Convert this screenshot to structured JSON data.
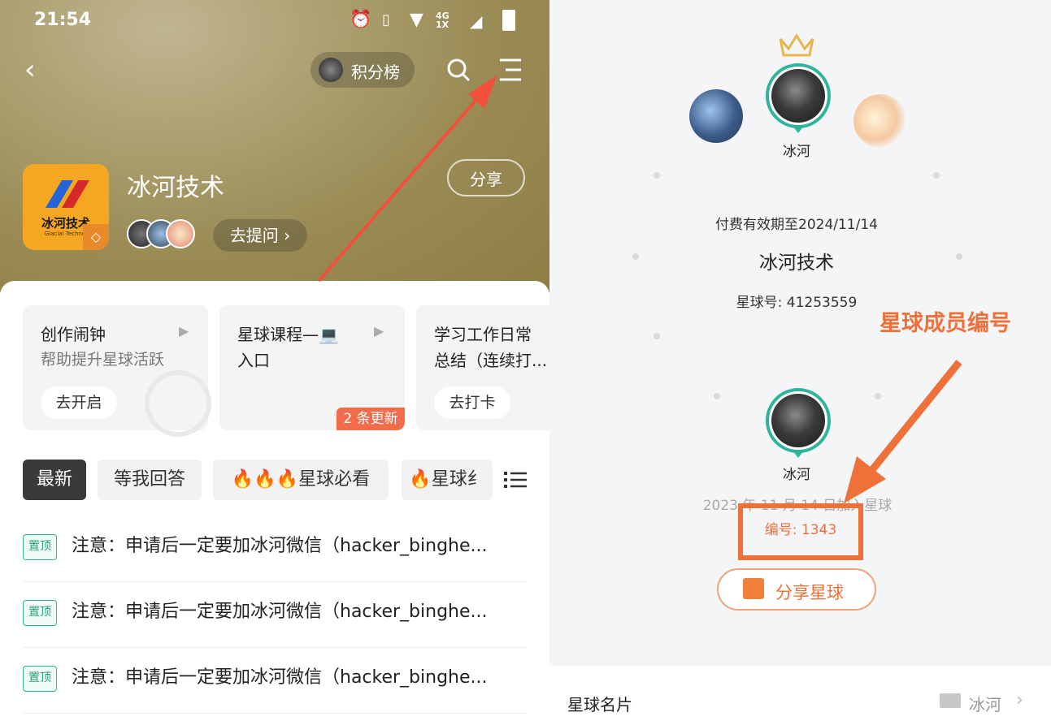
{
  "left": {
    "status_time": "21:54",
    "status_network": "4G 1X",
    "leaderboard_label": "积分榜",
    "group_name": "冰河技术",
    "share_label": "分享",
    "ask_label": "去提问 ›",
    "logo": {
      "text": "冰河技术",
      "subtext": "Glacial Technol"
    },
    "cards": [
      {
        "title": "创作闹钟",
        "subtitle": "帮助提升星球活跃",
        "button": "去开启"
      },
      {
        "title": "星球课程—💻",
        "subtitle": "入口",
        "badge": "2 条更新"
      },
      {
        "title": "学习工作日常",
        "subtitle": "总结（连续打...",
        "button": "去打卡"
      }
    ],
    "tabs": [
      "最新",
      "等我回答",
      "🔥🔥🔥星球必看",
      "🔥星球纟"
    ],
    "pin_label": "置顶",
    "posts": [
      "注意：申请后一定要加冰河微信（hacker_binghe...",
      "注意：申请后一定要加冰河微信（hacker_binghe...",
      "注意：申请后一定要加冰河微信（hacker_binghe..."
    ]
  },
  "right": {
    "top_user": "冰河",
    "expiry": "付费有效期至2024/11/14",
    "group_name": "冰河技术",
    "group_id": "星球号: 41253559",
    "annotation": "星球成员编号",
    "member_name": "冰河",
    "join_date": "2023 年 11 月 14 日加入星球",
    "member_no": "编号: 1343",
    "share_button": "分享星球",
    "card_label": "星球名片",
    "card_value": "冰河"
  },
  "colors": {
    "accent_orange": "#f0703a",
    "teal": "#2fb39a",
    "arrow_red": "#f0503c"
  }
}
